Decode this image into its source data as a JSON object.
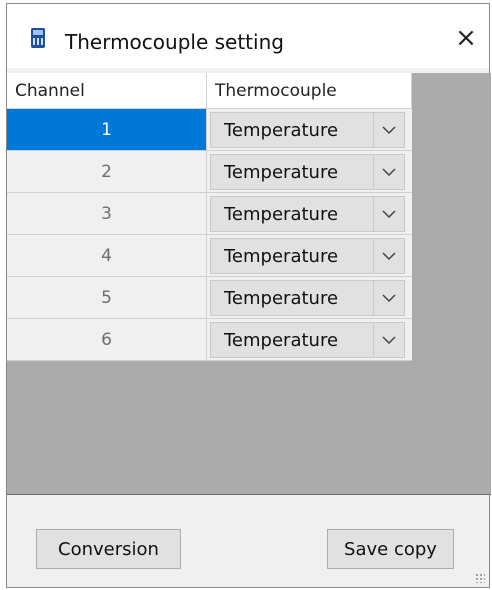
{
  "window": {
    "title": "Thermocouple setting",
    "close_glyph": "×"
  },
  "grid": {
    "columns": [
      "Channel",
      "Thermocouple"
    ],
    "rows": [
      {
        "channel": "1",
        "type": "Temperature",
        "selected": true
      },
      {
        "channel": "2",
        "type": "Temperature",
        "selected": false
      },
      {
        "channel": "3",
        "type": "Temperature",
        "selected": false
      },
      {
        "channel": "4",
        "type": "Temperature",
        "selected": false
      },
      {
        "channel": "5",
        "type": "Temperature",
        "selected": false
      },
      {
        "channel": "6",
        "type": "Temperature",
        "selected": false
      }
    ]
  },
  "buttons": {
    "conversion": "Conversion",
    "save_copy": "Save copy"
  },
  "icons": {
    "app": "calculator-icon",
    "close": "close-icon",
    "dropdown": "chevron-down-icon",
    "resize": "resize-grip-icon"
  },
  "colors": {
    "selection": "#0078d7",
    "grid_background": "#ababab",
    "window_background": "#f0f0f0"
  }
}
